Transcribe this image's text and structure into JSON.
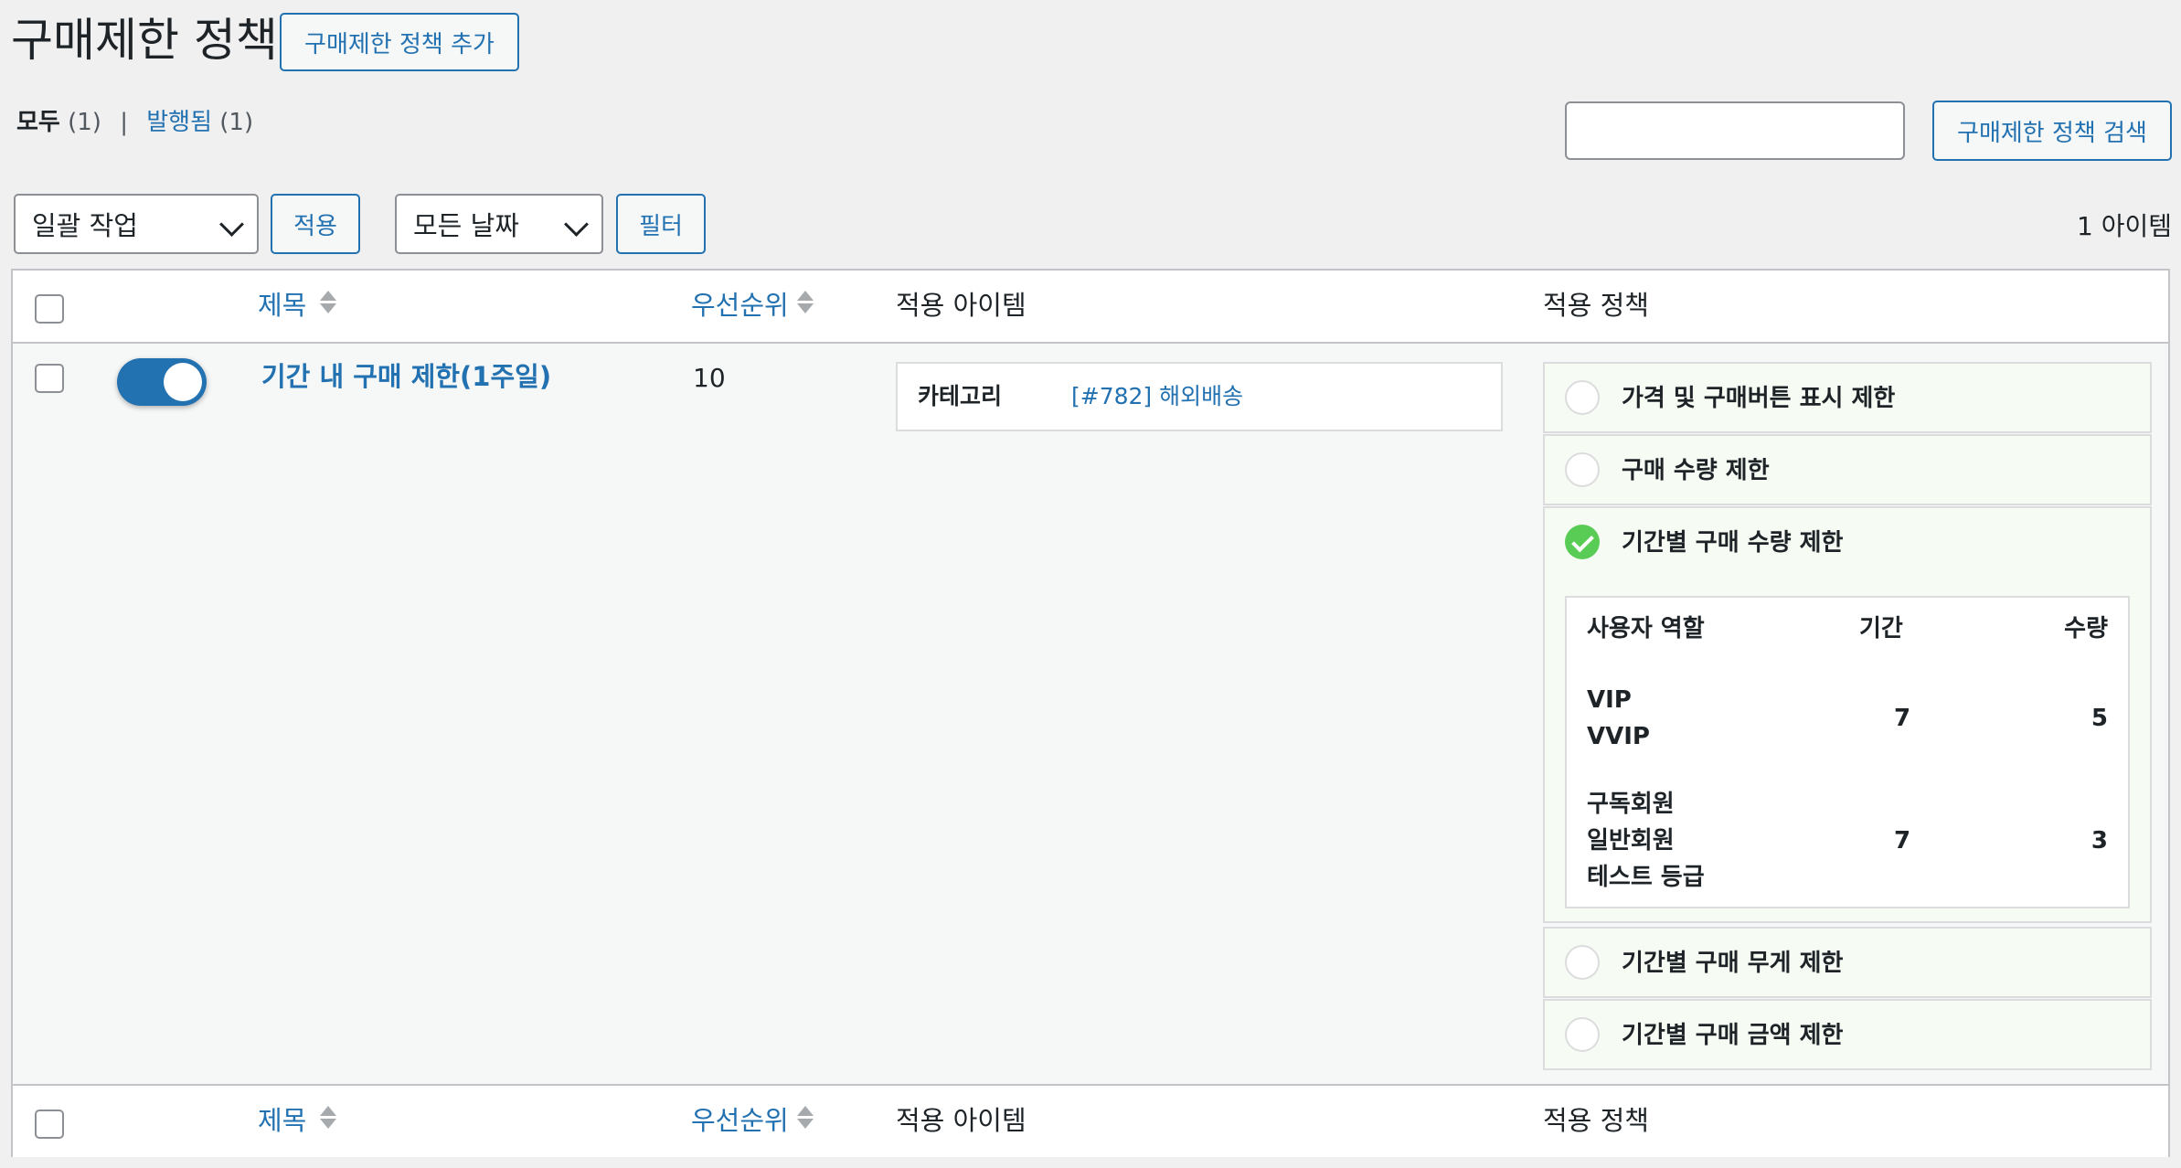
{
  "page": {
    "title": "구매제한 정책",
    "add_button": "구매제한 정책 추가"
  },
  "views": {
    "all_label": "모두",
    "all_count": "(1)",
    "separator": "|",
    "published_label": "발행됨",
    "published_count": "(1)"
  },
  "search": {
    "value": "",
    "button": "구매제한 정책 검색"
  },
  "toolbar": {
    "bulk_action": "일괄 작업",
    "apply_button": "적용",
    "date_filter": "모든 날짜",
    "filter_button": "필터",
    "item_count": "1 아이템"
  },
  "table": {
    "columns": {
      "title": "제목",
      "priority": "우선순위",
      "applied_items": "적용 아이템",
      "applied_policy": "적용 정책"
    },
    "row": {
      "enabled": true,
      "title": "기간 내 구매 제한(1주일)",
      "priority": "10",
      "item_type": "카테고리",
      "item_value": "[#782] 해외배송",
      "policies": [
        {
          "label": "가격 및 구매버튼 표시 제한",
          "checked": false
        },
        {
          "label": "구매 수량 제한",
          "checked": false
        },
        {
          "label": "기간별 구매 수량 제한",
          "checked": true
        },
        {
          "label": "기간별 구매 무게 제한",
          "checked": false
        },
        {
          "label": "기간별 구매 금액 제한",
          "checked": false
        }
      ],
      "limit_table": {
        "headers": [
          "사용자 역할",
          "기간",
          "수량"
        ],
        "rows": [
          {
            "roles": [
              "VIP",
              "VVIP"
            ],
            "period": "7",
            "quantity": "5"
          },
          {
            "roles": [
              "구독회원",
              "일반회원",
              "테스트 등급"
            ],
            "period": "7",
            "quantity": "3"
          }
        ]
      }
    }
  },
  "colors": {
    "accent": "#2271b1",
    "check_green": "#58cc55",
    "background": "#f0f0f1"
  }
}
